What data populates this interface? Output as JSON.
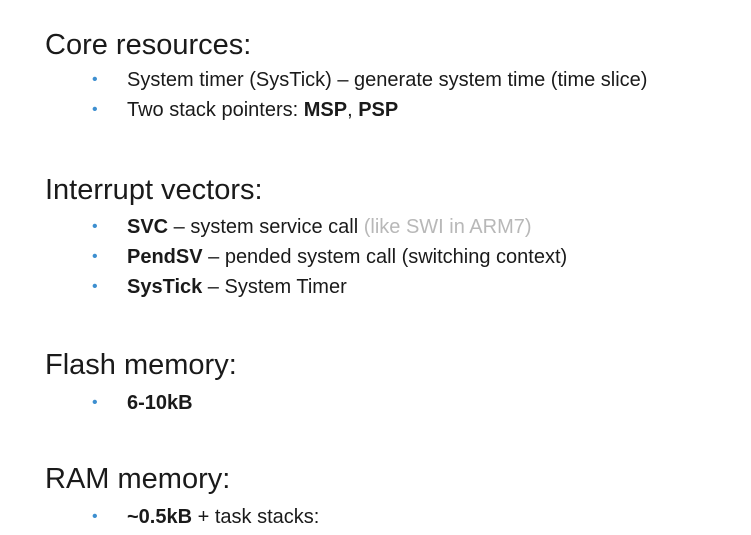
{
  "sections": [
    {
      "heading": "Core resources:",
      "items": [
        {
          "parts": [
            {
              "text": "System timer (SysTick) – generate system time (time slice)"
            }
          ]
        },
        {
          "parts": [
            {
              "text": "Two stack pointers: "
            },
            {
              "text": "MSP",
              "bold": true
            },
            {
              "text": ", "
            },
            {
              "text": "PSP",
              "bold": true
            }
          ]
        }
      ]
    },
    {
      "heading": "Interrupt vectors:",
      "items": [
        {
          "parts": [
            {
              "text": "SVC",
              "bold": true
            },
            {
              "text": " – system service call "
            },
            {
              "text": "(like SWI in ARM7)",
              "muted": true
            }
          ]
        },
        {
          "parts": [
            {
              "text": "PendSV",
              "bold": true
            },
            {
              "text": " – pended system call (switching context)"
            }
          ]
        },
        {
          "parts": [
            {
              "text": "SysTick",
              "bold": true
            },
            {
              "text": " – System Timer"
            }
          ]
        }
      ]
    },
    {
      "heading": "Flash memory:",
      "items": [
        {
          "parts": [
            {
              "text": "6-10kB",
              "bold": true
            }
          ]
        }
      ]
    },
    {
      "heading": "RAM memory:",
      "items": [
        {
          "parts": [
            {
              "text": "~0.5kB",
              "bold": true
            },
            {
              "text": " + task stacks:"
            }
          ]
        }
      ]
    }
  ],
  "bullet_char": "•",
  "colors": {
    "bullet": "#3d8fd0",
    "text": "#1a1a1a",
    "muted": "#b8b8b8"
  }
}
